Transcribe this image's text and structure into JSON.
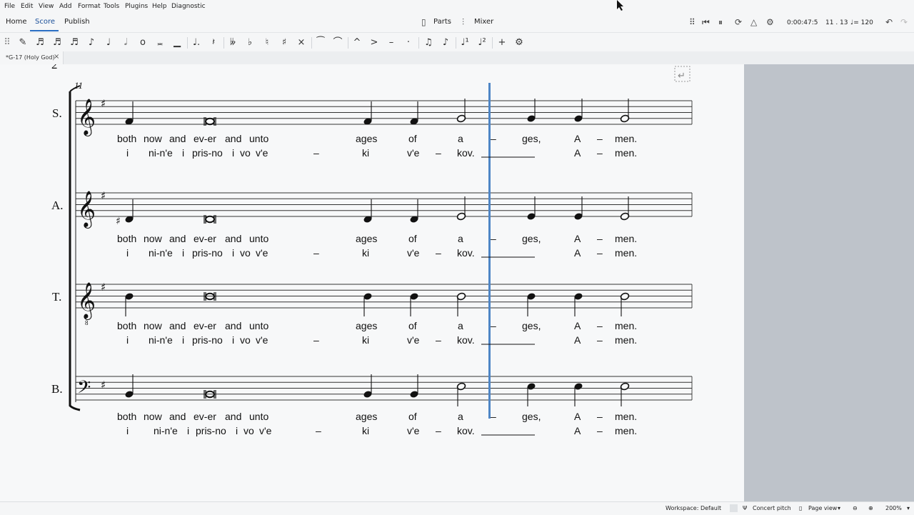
{
  "menubar": [
    "File",
    "Edit",
    "View",
    "Add",
    "Format",
    "Tools",
    "Plugins",
    "Help",
    "Diagnostic"
  ],
  "nav": {
    "home": "Home",
    "score": "Score",
    "publish": "Publish",
    "parts": "Parts",
    "mixer": "Mixer"
  },
  "playback": {
    "time": "0:00:47:5",
    "position": "11 . 13",
    "tempo": "♩= 120"
  },
  "document": {
    "tab_title": "*G-17 (Holy God)"
  },
  "score": {
    "measure_number": "11",
    "instruments": [
      "S.",
      "A.",
      "T.",
      "B."
    ],
    "lyrics_line1": [
      "both",
      "now",
      "and",
      "ev-er",
      "and",
      "unto",
      "ages",
      "of",
      "a",
      "–",
      "ges,",
      "A",
      "–",
      "men."
    ],
    "lyrics_line2": [
      "i",
      "ni-n'e",
      "i",
      "pris-no",
      "i",
      "vo",
      "v'e",
      "–",
      "ki",
      "v'e",
      "–",
      "kov.",
      "A",
      "–",
      "men."
    ]
  },
  "statusbar": {
    "workspace": "Workspace: Default",
    "concert_pitch": "Concert pitch",
    "view_mode": "Page view",
    "zoom": "200%"
  }
}
